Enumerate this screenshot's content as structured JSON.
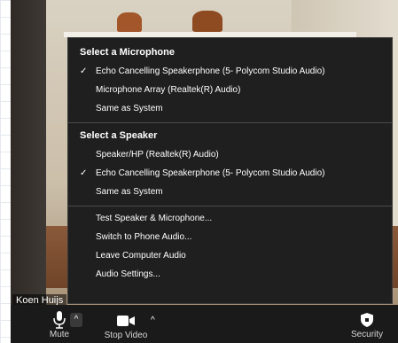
{
  "microphone": {
    "header": "Select a Microphone",
    "items": [
      {
        "label": "Echo Cancelling Speakerphone (5- Polycom Studio Audio)",
        "checked": true
      },
      {
        "label": "Microphone Array (Realtek(R) Audio)",
        "checked": false
      },
      {
        "label": "Same as System",
        "checked": false
      }
    ]
  },
  "speaker": {
    "header": "Select a Speaker",
    "items": [
      {
        "label": "Speaker/HP (Realtek(R) Audio)",
        "checked": false
      },
      {
        "label": "Echo Cancelling Speakerphone (5- Polycom Studio Audio)",
        "checked": true
      },
      {
        "label": "Same as System",
        "checked": false
      }
    ]
  },
  "actions": {
    "items": [
      {
        "label": "Test Speaker & Microphone..."
      },
      {
        "label": "Switch to Phone Audio..."
      },
      {
        "label": "Leave Computer Audio"
      },
      {
        "label": "Audio Settings..."
      }
    ]
  },
  "check_glyph": "✓",
  "participant": {
    "name": "Koen Huijs"
  },
  "toolbar": {
    "mute_label": "Mute",
    "stop_video_label": "Stop Video",
    "security_label": "Security",
    "caret": "^",
    "icons": {
      "mute": "microphone-icon",
      "video": "video-camera-icon",
      "security": "shield-icon"
    }
  },
  "colors": {
    "menu_bg": "#1f1f1f",
    "toolbar_bg": "#1a1a1a",
    "text": "#ffffff"
  }
}
